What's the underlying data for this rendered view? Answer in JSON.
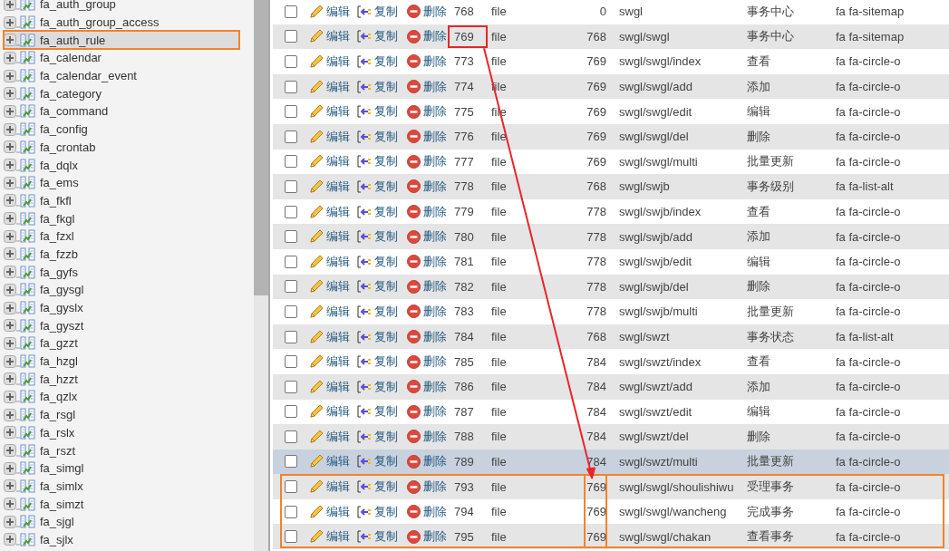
{
  "sidebar": {
    "items": [
      {
        "label": "fa_auth_group",
        "selected": false
      },
      {
        "label": "fa_auth_group_access",
        "selected": false
      },
      {
        "label": "fa_auth_rule",
        "selected": true
      },
      {
        "label": "fa_calendar",
        "selected": false
      },
      {
        "label": "fa_calendar_event",
        "selected": false
      },
      {
        "label": "fa_category",
        "selected": false
      },
      {
        "label": "fa_command",
        "selected": false
      },
      {
        "label": "fa_config",
        "selected": false
      },
      {
        "label": "fa_crontab",
        "selected": false
      },
      {
        "label": "fa_dqlx",
        "selected": false
      },
      {
        "label": "fa_ems",
        "selected": false
      },
      {
        "label": "fa_fkfl",
        "selected": false
      },
      {
        "label": "fa_fkgl",
        "selected": false
      },
      {
        "label": "fa_fzxl",
        "selected": false
      },
      {
        "label": "fa_fzzb",
        "selected": false
      },
      {
        "label": "fa_gyfs",
        "selected": false
      },
      {
        "label": "fa_gysgl",
        "selected": false
      },
      {
        "label": "fa_gyslx",
        "selected": false
      },
      {
        "label": "fa_gyszt",
        "selected": false
      },
      {
        "label": "fa_gzzt",
        "selected": false
      },
      {
        "label": "fa_hzgl",
        "selected": false
      },
      {
        "label": "fa_hzzt",
        "selected": false
      },
      {
        "label": "fa_qzlx",
        "selected": false
      },
      {
        "label": "fa_rsgl",
        "selected": false
      },
      {
        "label": "fa_rslx",
        "selected": false
      },
      {
        "label": "fa_rszt",
        "selected": false
      },
      {
        "label": "fa_simgl",
        "selected": false
      },
      {
        "label": "fa_simlx",
        "selected": false
      },
      {
        "label": "fa_simzt",
        "selected": false
      },
      {
        "label": "fa_sjgl",
        "selected": false
      },
      {
        "label": "fa_sjlx",
        "selected": false
      }
    ]
  },
  "table": {
    "rows": [
      {
        "actions": [
          "编辑",
          "复制",
          "删除"
        ],
        "id": "768",
        "type": "file",
        "pid": "0",
        "name": "swgl",
        "title": "事务中心",
        "icon": "fa fa-sitemap",
        "checked": false,
        "hover": false,
        "id_boxed": false,
        "group_boxed": false
      },
      {
        "actions": [
          "编辑",
          "复制",
          "删除"
        ],
        "id": "769",
        "type": "file",
        "pid": "768",
        "name": "swgl/swgl",
        "title": "事务中心",
        "icon": "fa fa-sitemap",
        "checked": false,
        "hover": false,
        "id_boxed": true,
        "group_boxed": false
      },
      {
        "actions": [
          "编辑",
          "复制",
          "删除"
        ],
        "id": "773",
        "type": "file",
        "pid": "769",
        "name": "swgl/swgl/index",
        "title": "查看",
        "icon": "fa fa-circle-o",
        "checked": false,
        "hover": false,
        "id_boxed": false,
        "group_boxed": false
      },
      {
        "actions": [
          "编辑",
          "复制",
          "删除"
        ],
        "id": "774",
        "type": "file",
        "pid": "769",
        "name": "swgl/swgl/add",
        "title": "添加",
        "icon": "fa fa-circle-o",
        "checked": false,
        "hover": false,
        "id_boxed": false,
        "group_boxed": false
      },
      {
        "actions": [
          "编辑",
          "复制",
          "删除"
        ],
        "id": "775",
        "type": "file",
        "pid": "769",
        "name": "swgl/swgl/edit",
        "title": "编辑",
        "icon": "fa fa-circle-o",
        "checked": false,
        "hover": false,
        "id_boxed": false,
        "group_boxed": false
      },
      {
        "actions": [
          "编辑",
          "复制",
          "删除"
        ],
        "id": "776",
        "type": "file",
        "pid": "769",
        "name": "swgl/swgl/del",
        "title": "删除",
        "icon": "fa fa-circle-o",
        "checked": false,
        "hover": false,
        "id_boxed": false,
        "group_boxed": false
      },
      {
        "actions": [
          "编辑",
          "复制",
          "删除"
        ],
        "id": "777",
        "type": "file",
        "pid": "769",
        "name": "swgl/swgl/multi",
        "title": "批量更新",
        "icon": "fa fa-circle-o",
        "checked": false,
        "hover": false,
        "id_boxed": false,
        "group_boxed": false
      },
      {
        "actions": [
          "编辑",
          "复制",
          "删除"
        ],
        "id": "778",
        "type": "file",
        "pid": "768",
        "name": "swgl/swjb",
        "title": "事务级别",
        "icon": "fa fa-list-alt",
        "checked": false,
        "hover": false,
        "id_boxed": false,
        "group_boxed": false
      },
      {
        "actions": [
          "编辑",
          "复制",
          "删除"
        ],
        "id": "779",
        "type": "file",
        "pid": "778",
        "name": "swgl/swjb/index",
        "title": "查看",
        "icon": "fa fa-circle-o",
        "checked": false,
        "hover": false,
        "id_boxed": false,
        "group_boxed": false
      },
      {
        "actions": [
          "编辑",
          "复制",
          "删除"
        ],
        "id": "780",
        "type": "file",
        "pid": "778",
        "name": "swgl/swjb/add",
        "title": "添加",
        "icon": "fa fa-circle-o",
        "checked": false,
        "hover": false,
        "id_boxed": false,
        "group_boxed": false
      },
      {
        "actions": [
          "编辑",
          "复制",
          "删除"
        ],
        "id": "781",
        "type": "file",
        "pid": "778",
        "name": "swgl/swjb/edit",
        "title": "编辑",
        "icon": "fa fa-circle-o",
        "checked": false,
        "hover": false,
        "id_boxed": false,
        "group_boxed": false
      },
      {
        "actions": [
          "编辑",
          "复制",
          "删除"
        ],
        "id": "782",
        "type": "file",
        "pid": "778",
        "name": "swgl/swjb/del",
        "title": "删除",
        "icon": "fa fa-circle-o",
        "checked": false,
        "hover": false,
        "id_boxed": false,
        "group_boxed": false
      },
      {
        "actions": [
          "编辑",
          "复制",
          "删除"
        ],
        "id": "783",
        "type": "file",
        "pid": "778",
        "name": "swgl/swjb/multi",
        "title": "批量更新",
        "icon": "fa fa-circle-o",
        "checked": false,
        "hover": false,
        "id_boxed": false,
        "group_boxed": false
      },
      {
        "actions": [
          "编辑",
          "复制",
          "删除"
        ],
        "id": "784",
        "type": "file",
        "pid": "768",
        "name": "swgl/swzt",
        "title": "事务状态",
        "icon": "fa fa-list-alt",
        "checked": false,
        "hover": false,
        "id_boxed": false,
        "group_boxed": false
      },
      {
        "actions": [
          "编辑",
          "复制",
          "删除"
        ],
        "id": "785",
        "type": "file",
        "pid": "784",
        "name": "swgl/swzt/index",
        "title": "查看",
        "icon": "fa fa-circle-o",
        "checked": false,
        "hover": false,
        "id_boxed": false,
        "group_boxed": false
      },
      {
        "actions": [
          "编辑",
          "复制",
          "删除"
        ],
        "id": "786",
        "type": "file",
        "pid": "784",
        "name": "swgl/swzt/add",
        "title": "添加",
        "icon": "fa fa-circle-o",
        "checked": false,
        "hover": false,
        "id_boxed": false,
        "group_boxed": false
      },
      {
        "actions": [
          "编辑",
          "复制",
          "删除"
        ],
        "id": "787",
        "type": "file",
        "pid": "784",
        "name": "swgl/swzt/edit",
        "title": "编辑",
        "icon": "fa fa-circle-o",
        "checked": false,
        "hover": false,
        "id_boxed": false,
        "group_boxed": false
      },
      {
        "actions": [
          "编辑",
          "复制",
          "删除"
        ],
        "id": "788",
        "type": "file",
        "pid": "784",
        "name": "swgl/swzt/del",
        "title": "删除",
        "icon": "fa fa-circle-o",
        "checked": false,
        "hover": false,
        "id_boxed": false,
        "group_boxed": false
      },
      {
        "actions": [
          "编辑",
          "复制",
          "删除"
        ],
        "id": "789",
        "type": "file",
        "pid": "784",
        "name": "swgl/swzt/multi",
        "title": "批量更新",
        "icon": "fa fa-circle-o",
        "checked": false,
        "hover": true,
        "id_boxed": false,
        "group_boxed": false
      },
      {
        "actions": [
          "编辑",
          "复制",
          "删除"
        ],
        "id": "793",
        "type": "file",
        "pid": "769",
        "name": "swgl/swgl/shoulishiwu",
        "title": "受理事务",
        "icon": "fa fa-circle-o",
        "checked": false,
        "hover": false,
        "id_boxed": false,
        "group_boxed": true
      },
      {
        "actions": [
          "编辑",
          "复制",
          "删除"
        ],
        "id": "794",
        "type": "file",
        "pid": "769",
        "name": "swgl/swgl/wancheng",
        "title": "完成事务",
        "icon": "fa fa-circle-o",
        "checked": false,
        "hover": false,
        "id_boxed": false,
        "group_boxed": true
      },
      {
        "actions": [
          "编辑",
          "复制",
          "删除"
        ],
        "id": "795",
        "type": "file",
        "pid": "769",
        "name": "swgl/swgl/chakan",
        "title": "查看事务",
        "icon": "fa fa-circle-o",
        "checked": false,
        "hover": false,
        "id_boxed": false,
        "group_boxed": true
      }
    ]
  }
}
